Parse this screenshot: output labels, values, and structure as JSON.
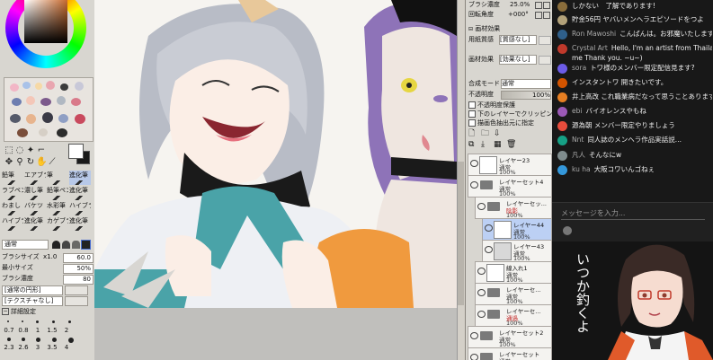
{
  "left_panel": {
    "tools": [
      {
        "label": "鉛筆",
        "selected": false
      },
      {
        "label": "エアブラ",
        "selected": false
      },
      {
        "label": "筆",
        "selected": false
      },
      {
        "label": "進化筆",
        "selected": true
      },
      {
        "label": "ラブペン",
        "selected": false
      },
      {
        "label": "濃し筆",
        "selected": false
      },
      {
        "label": "鉛筆ペン",
        "selected": false
      },
      {
        "label": "進化筆",
        "selected": false
      },
      {
        "label": "わまし",
        "selected": false
      },
      {
        "label": "バケツ",
        "selected": false
      },
      {
        "label": "水彩筆",
        "selected": false
      },
      {
        "label": "ハイブラ",
        "selected": false
      },
      {
        "label": "ハイブラシ",
        "selected": false
      },
      {
        "label": "進化筆",
        "selected": false
      },
      {
        "label": "カゲブラ",
        "selected": false
      },
      {
        "label": "進化筆",
        "selected": false
      }
    ],
    "blend_mode": "通常",
    "brush_size_label": "ブラシサイズ",
    "brush_size_mult": "x1.0",
    "brush_size_value": "60.0",
    "min_size_label": "最小サイズ",
    "min_size_value": "50%",
    "brush_density_label": "ブラシ濃度",
    "brush_density_value": "80",
    "shape_label": "[通常の円形]",
    "texture_label": "[テクスチャなし]",
    "detail_label": "詳細設定",
    "size_grid": [
      [
        "0.7",
        "0.8",
        "1",
        "1.5",
        "2"
      ],
      [
        "2.3",
        "2.6",
        "3",
        "3.5",
        "4"
      ]
    ]
  },
  "layer_panel": {
    "top_rows": [
      {
        "label": "ブラシ濃度",
        "value": "25.0%"
      },
      {
        "label": "回転角度",
        "value": "+000°"
      }
    ],
    "texture_header": "画材効果",
    "paper_label": "用紙質感",
    "paper_value": "[質感なし]",
    "material_label": "画材効果",
    "material_value": "[効果なし]",
    "composite_label": "合成モード",
    "composite_value": "通常",
    "opacity_label": "不透明度",
    "opacity_value": "100%",
    "checks": [
      "不透明度保護",
      "下のレイヤーでクリッピング",
      "描画色抽出元に指定"
    ],
    "layers": [
      {
        "name": "レイヤー23",
        "mode": "通常",
        "opacity": "100%",
        "type": "layer",
        "selected": false,
        "indent": 0
      },
      {
        "name": "レイヤーセット4",
        "mode": "通常",
        "opacity": "100%",
        "type": "folder",
        "selected": false,
        "indent": 0
      },
      {
        "name": "レイヤーセッ...",
        "mode": "陰影",
        "opacity": "100%",
        "type": "folder",
        "selected": false,
        "indent": 1,
        "mode_red": true
      },
      {
        "name": "レイヤー44",
        "mode": "通常",
        "opacity": "100%",
        "type": "layer",
        "selected": true,
        "indent": 2
      },
      {
        "name": "レイヤー43",
        "mode": "通常",
        "opacity": "100%",
        "type": "layer",
        "selected": false,
        "indent": 2
      },
      {
        "name": "線入れ1",
        "mode": "通常",
        "opacity": "100%",
        "type": "layer",
        "selected": false,
        "indent": 1
      },
      {
        "name": "レイヤーセ...",
        "mode": "通常",
        "opacity": "100%",
        "type": "folder",
        "selected": false,
        "indent": 1
      },
      {
        "name": "レイヤーセ...",
        "mode": "通過",
        "opacity": "100%",
        "type": "folder",
        "selected": false,
        "indent": 1,
        "mode_red": true
      },
      {
        "name": "レイヤーセット2",
        "mode": "通常",
        "opacity": "100%",
        "type": "folder",
        "selected": false,
        "indent": 0
      },
      {
        "name": "レイヤーセット",
        "mode": "通常",
        "opacity": "",
        "type": "folder",
        "selected": false,
        "indent": 0
      }
    ]
  },
  "chat": {
    "messages": [
      {
        "author": "",
        "text": "しかない　了解であります!",
        "color": "#8a6d3b"
      },
      {
        "author": "",
        "text": "貯金56円 ヤバいメンヘラエピソードをつよ",
        "color": "#b3a27a"
      },
      {
        "author": "Ron Mawoshi",
        "text": "こんばんは。お邪魔いたします",
        "color": "#2f5f8a"
      },
      {
        "author": "Crystal Art",
        "text": "Hello, I'm an artist from Thailand I'm",
        "color": "#c0392b"
      },
      {
        "author": "",
        "text": "me Thank you. ~u~)",
        "color": ""
      },
      {
        "author": "sora",
        "text": "トワ様のメンバー限定配信見ます?",
        "color": "#6c5ce7"
      },
      {
        "author": "",
        "text": "インスタントワ 開きたいです。",
        "color": "#d35400"
      },
      {
        "author": "",
        "text": "井上高改 これ職業病だなって思うことあります",
        "color": "#e67e22"
      },
      {
        "author": "ebi",
        "text": "バイオレンスやもね",
        "color": "#9b59b6"
      },
      {
        "author": "",
        "text": "源為朝 メンバー限定やりましょう",
        "color": "#e74c3c"
      },
      {
        "author": "Nnt",
        "text": "同人誌のメンヘラ作品実話説...",
        "color": "#16a085"
      },
      {
        "author": "凡人",
        "text": "そんなにw",
        "color": "#7f8c8d"
      },
      {
        "author": "ku ha",
        "text": "大阪コワいんゴねぇ",
        "color": "#3498db"
      }
    ],
    "input_placeholder": "メッセージを入力...",
    "vtuber_caption": "いつか釣くよ"
  },
  "colors": {
    "accent_blue": "#bcd0f4",
    "chat_bg": "#181818",
    "panel_bg": "#d8d6d0"
  }
}
